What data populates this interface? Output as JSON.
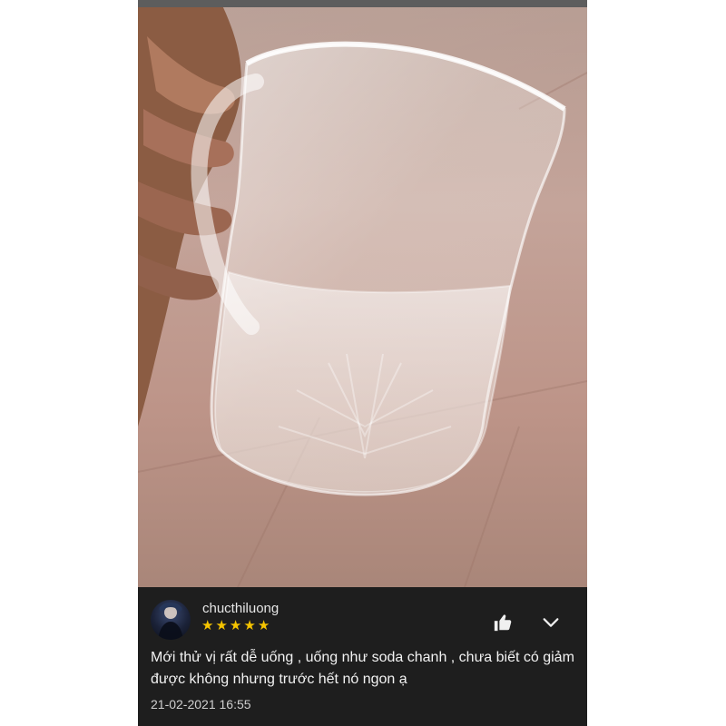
{
  "review": {
    "username": "chucthiluong",
    "rating": 5,
    "stars": [
      "★",
      "★",
      "★",
      "★",
      "★"
    ],
    "text": "Mới thử vị rất dễ uống , uống như soda chanh , chưa biết có giảm được không nhưng trước hết nó ngon ạ",
    "timestamp": "21-02-2021 16:55",
    "icons": {
      "avatar": "user-avatar",
      "like": "thumbs-up-icon",
      "more": "chevron-down-icon"
    }
  },
  "colors": {
    "panel_bg": "#1e1e1e",
    "star": "#f5c400",
    "text": "#f2f2f2"
  }
}
